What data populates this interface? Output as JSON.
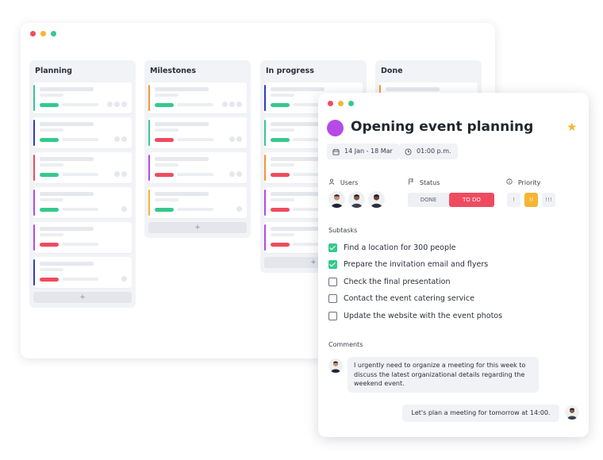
{
  "board": {
    "columns": [
      {
        "title": "Planning",
        "cards": [
          {
            "accent": "#35c98e",
            "tag": "#35c98e",
            "avatars": 3
          },
          {
            "accent": "#2f3ec2",
            "tag": "#35c98e",
            "avatars": 2
          },
          {
            "accent": "#ef4b5f",
            "tag": "#35c98e",
            "avatars": 2
          },
          {
            "accent": "#b54ae6",
            "tag": "#35c98e",
            "avatars": 1
          },
          {
            "accent": "#b54ae6",
            "tag": "#ef4b5f",
            "avatars": 0
          },
          {
            "accent": "#2f3ec2",
            "tag": "#ef4b5f",
            "avatars": 1
          }
        ],
        "add": "+"
      },
      {
        "title": "Milestones",
        "cards": [
          {
            "accent": "#f5963a",
            "tag": "#35c98e",
            "avatars": 3
          },
          {
            "accent": "#35c98e",
            "tag": "#ef4b5f",
            "avatars": 2
          },
          {
            "accent": "#b54ae6",
            "tag": "#ef4b5f",
            "avatars": 2
          },
          {
            "accent": "#f5b533",
            "tag": "#35c98e",
            "avatars": 1
          }
        ],
        "add": "+"
      },
      {
        "title": "In progress",
        "cards": [
          {
            "accent": "#2f3ec2",
            "tag": "#35c98e",
            "avatars": 0
          },
          {
            "accent": "#35c98e",
            "tag": "#35c98e",
            "avatars": 0
          },
          {
            "accent": "#f5963a",
            "tag": "#ef4b5f",
            "avatars": 0
          },
          {
            "accent": "#b54ae6",
            "tag": "#ef4b5f",
            "avatars": 0
          },
          {
            "accent": "#b54ae6",
            "tag": "#ef4b5f",
            "avatars": 0
          }
        ],
        "add": "+"
      },
      {
        "title": "Done",
        "cards": [
          {
            "accent": "#f5963a",
            "tag": "#35c98e",
            "avatars": 0
          }
        ],
        "add": ""
      }
    ]
  },
  "task": {
    "title": "Opening event planning",
    "date_range": "14 Jan - 18 Mar",
    "time": "01:00 p.m.",
    "users_label": "Users",
    "status_label": "Status",
    "priority_label": "Priority",
    "status_done": "DONE",
    "status_todo": "TO DO",
    "priority_levels": [
      "!",
      "!!",
      "!!!"
    ],
    "subtasks_label": "Subtasks",
    "subtasks": [
      {
        "text": "Find a location for 300 people",
        "checked": true
      },
      {
        "text": "Prepare the invitation email and flyers",
        "checked": true
      },
      {
        "text": "Check the final presentation",
        "checked": false
      },
      {
        "text": "Contact the event catering service",
        "checked": false
      },
      {
        "text": "Update the website with the event photos",
        "checked": false
      }
    ],
    "comments_label": "Comments",
    "comment_1_lines": [
      "I urgently need to organize a meeting for this week to",
      "discuss the latest organizational details regarding the",
      "weekend event."
    ],
    "comment_2": "Let's plan a meeting for tomorrow at 14:00."
  },
  "colors": {
    "accent_purple": "#b54ae6",
    "todo_red": "#ef4b5f",
    "priority_yellow": "#f5b533",
    "check_green": "#35c98e"
  }
}
